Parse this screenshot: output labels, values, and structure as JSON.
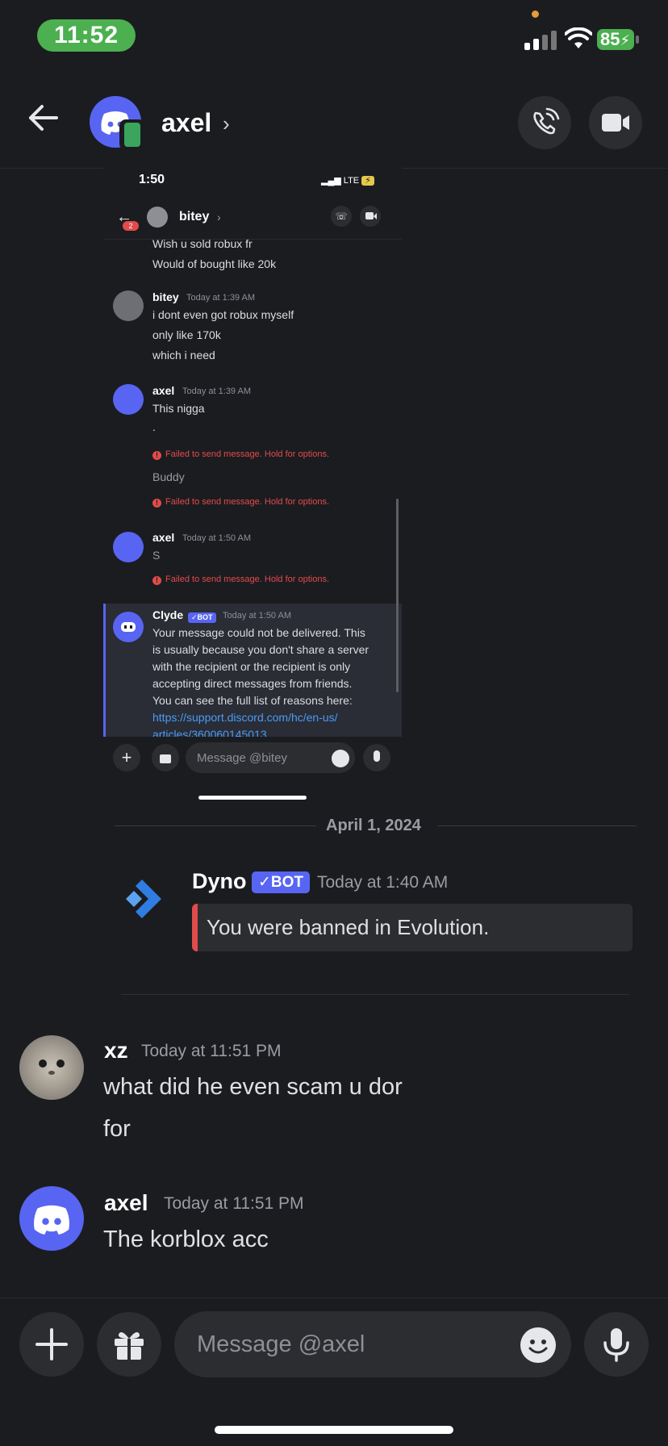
{
  "status_bar": {
    "time": "11:52",
    "battery": "85"
  },
  "header": {
    "name": "axel",
    "chevron": "›"
  },
  "embedded_screenshot": {
    "status_time": "1:50",
    "network": "LTE",
    "header_name": "bitey",
    "header_chevron": "›",
    "badge_count": "2",
    "lines_top": [
      "Wish u sold robux fr",
      "Would of bought like 20k"
    ],
    "messages": [
      {
        "author": "bitey",
        "timestamp": "Today at 1:39 AM",
        "lines": [
          "i dont even got robux myself",
          "only like 170k",
          "which i need"
        ]
      },
      {
        "author": "axel",
        "timestamp": "Today at 1:39 AM",
        "lines": [
          "This nigga",
          "."
        ],
        "error": "Failed to send message. Hold for options.",
        "followup": "Buddy",
        "followup_error": "Failed to send message. Hold for options."
      },
      {
        "author": "axel",
        "timestamp": "Today at 1:50 AM",
        "lines": [
          "S"
        ],
        "error": "Failed to send message. Hold for options."
      }
    ],
    "clyde": {
      "author": "Clyde",
      "badge": "✓BOT",
      "timestamp": "Today at 1:50 AM",
      "lines": [
        "Your message could not be delivered. This",
        "is usually because you don't share a server",
        "with the recipient or the recipient is only",
        "accepting direct messages from friends.",
        "You can see the full list of reasons here:",
        "https://support.discord.com/hc/en-us/",
        "articles/360060145013"
      ]
    },
    "input_placeholder": "Message @bitey"
  },
  "date_divider": "April 1, 2024",
  "dyno": {
    "author": "Dyno",
    "badge": "✓BOT",
    "timestamp": "Today at 1:40 AM",
    "embed_text": "You were banned in Evolution."
  },
  "messages": [
    {
      "author": "xz",
      "timestamp": "Today at 11:51 PM",
      "lines": [
        "what did he even scam u dor",
        "for"
      ]
    },
    {
      "author": "axel",
      "timestamp": "Today at 11:51 PM",
      "lines": [
        "The korblox acc"
      ]
    }
  ],
  "composer": {
    "placeholder": "Message @axel"
  },
  "colors": {
    "background": "#1b1c20",
    "blurple": "#5865f2",
    "status_green": "#4caf50",
    "error_red": "#e24b4b"
  },
  "icons": [
    "back-arrow-icon",
    "mobile-icon",
    "phone-call-icon",
    "video-camera-icon",
    "plus-icon",
    "gift-icon",
    "emoji-icon",
    "microphone-icon",
    "discord-logo-icon",
    "dyno-logo-icon",
    "wifi-icon",
    "signal-icon",
    "battery-icon"
  ]
}
